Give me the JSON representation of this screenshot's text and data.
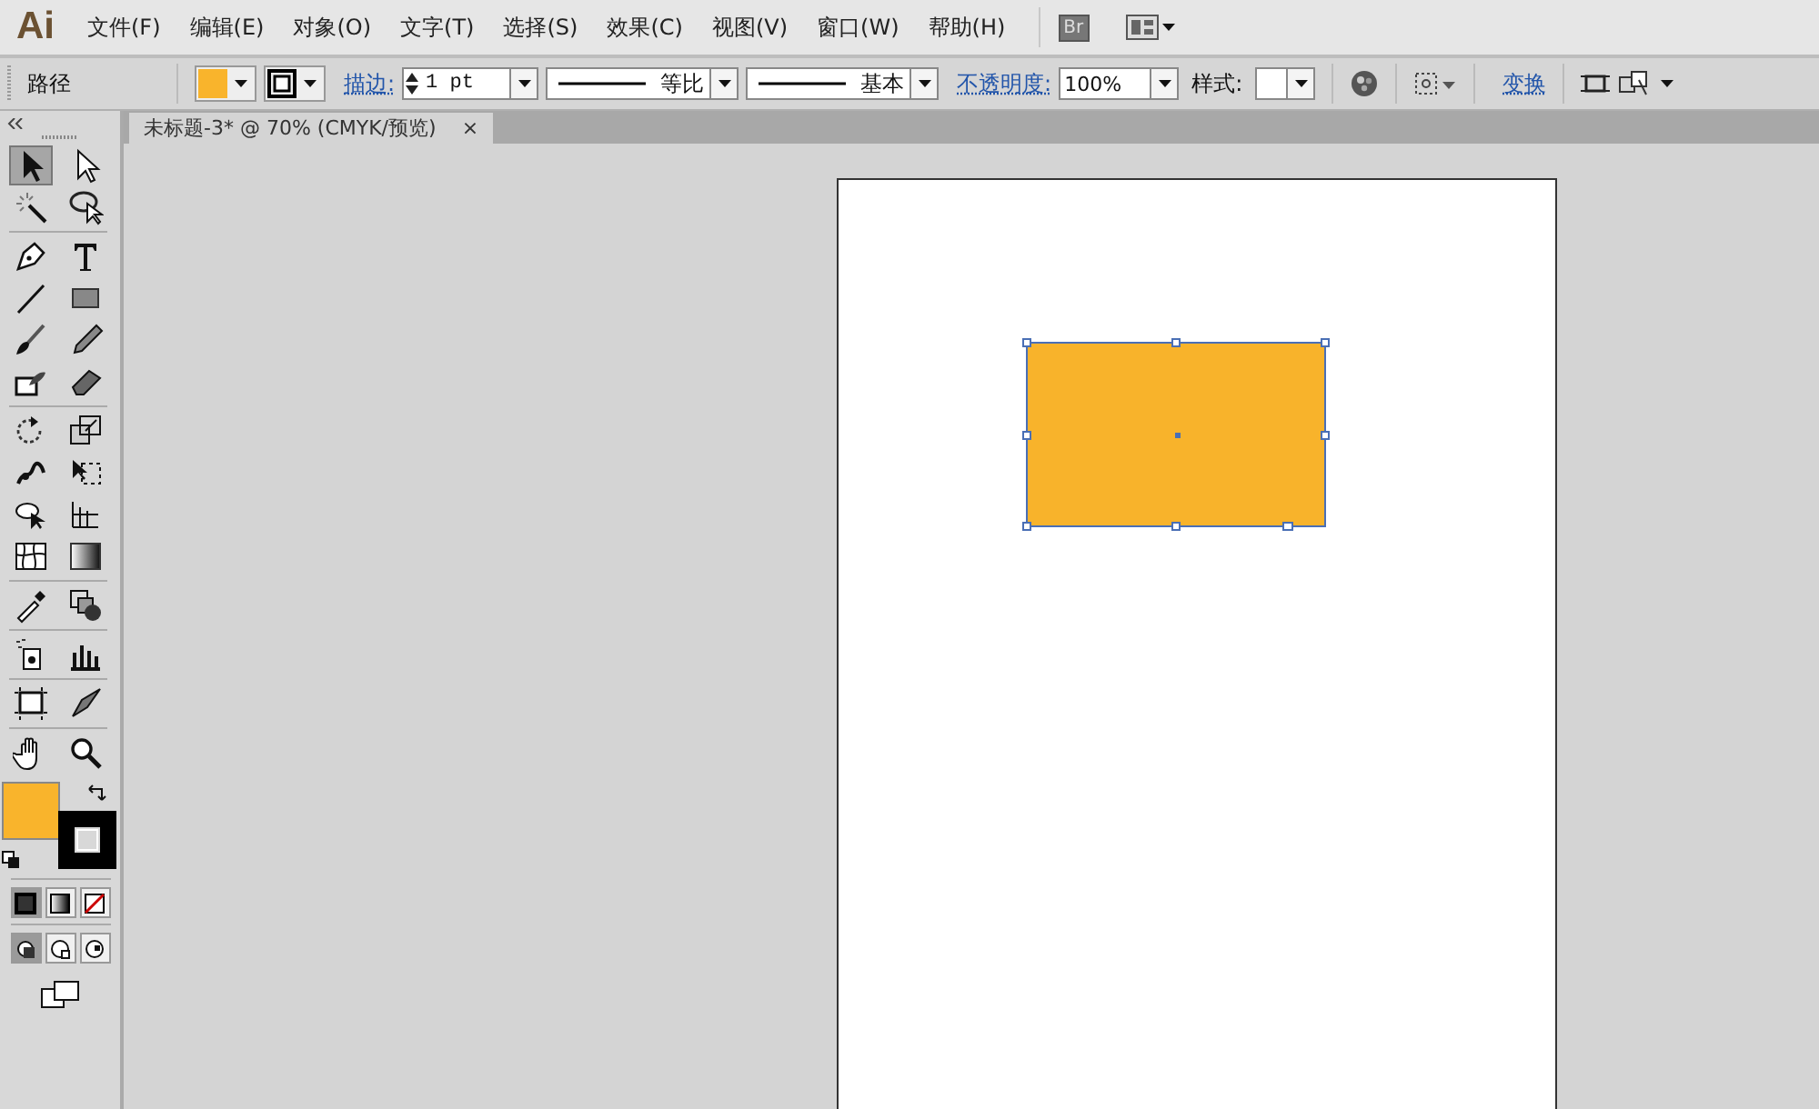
{
  "menu_bar": {
    "logo": "Ai",
    "items": [
      "文件(F)",
      "编辑(E)",
      "对象(O)",
      "文字(T)",
      "选择(S)",
      "效果(C)",
      "视图(V)",
      "窗口(W)",
      "帮助(H)"
    ],
    "bridge": "Br"
  },
  "control_bar": {
    "selection": "路径",
    "fill": {
      "color": "#f9b42c"
    },
    "stroke_label": "描边:",
    "stroke_weight": "1 pt",
    "profile": "等比",
    "brush": "基本",
    "opacity_label": "不透明度:",
    "opacity": "100%",
    "style_label": "样式:",
    "transform": "变换"
  },
  "document_tab": {
    "title": "未标题-3* @ 70% (CMYK/预览)",
    "close": "×"
  },
  "tools": [
    {
      "kind": "select",
      "selected": true
    },
    {
      "kind": "direct",
      "selected": false
    },
    {
      "kind": "wand",
      "selected": false
    },
    {
      "kind": "lasso",
      "selected": false
    },
    {
      "kind": "pen",
      "selected": false
    },
    {
      "kind": "type",
      "selected": false
    },
    {
      "kind": "line",
      "selected": false
    },
    {
      "kind": "rect",
      "selected": false
    },
    {
      "kind": "brush",
      "selected": false
    },
    {
      "kind": "pencil",
      "selected": false
    },
    {
      "kind": "blob",
      "selected": false
    },
    {
      "kind": "eraser",
      "selected": false
    },
    {
      "kind": "rotate",
      "selected": false
    },
    {
      "kind": "scale",
      "selected": false
    },
    {
      "kind": "warp",
      "selected": false
    },
    {
      "kind": "freetransform",
      "selected": false
    },
    {
      "kind": "shapebuilder",
      "selected": false
    },
    {
      "kind": "perspective",
      "selected": false
    },
    {
      "kind": "mesh",
      "selected": false
    },
    {
      "kind": "gradient",
      "selected": false
    },
    {
      "kind": "eyedropper",
      "selected": false
    },
    {
      "kind": "blend",
      "selected": false
    },
    {
      "kind": "spray",
      "selected": false
    },
    {
      "kind": "graph",
      "selected": false
    },
    {
      "kind": "artboard",
      "selected": false
    },
    {
      "kind": "slice",
      "selected": false
    },
    {
      "kind": "hand",
      "selected": false
    },
    {
      "kind": "zoom",
      "selected": false
    }
  ],
  "color_modes": [
    {
      "kind": "color",
      "selected": true
    },
    {
      "kind": "gradient",
      "selected": false
    },
    {
      "kind": "none",
      "selected": false
    }
  ],
  "draw_modes": [
    {
      "selected": true
    },
    {
      "selected": false
    },
    {
      "selected": false
    }
  ],
  "shape": {
    "color": "#f8b32b",
    "selected": true
  }
}
